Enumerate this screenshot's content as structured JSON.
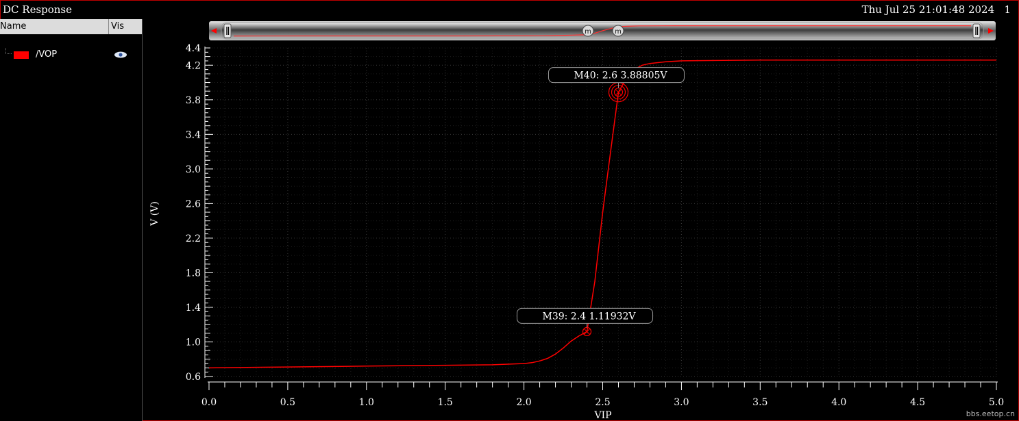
{
  "window": {
    "title": "DC Response",
    "timestamp": "Thu Jul 25 21:01:48 2024",
    "page_number": "1"
  },
  "legend": {
    "header_name": "Name",
    "header_vis": "Vis",
    "items": [
      {
        "label": "/VOP",
        "color": "#ff0000",
        "visibility_icon": "eye-icon"
      }
    ]
  },
  "zoom_bar": {
    "marker_label": "m",
    "left_arrow_icon": "arrow-left-icon",
    "right_arrow_icon": "arrow-right-icon"
  },
  "watermark": "bbs.eetop.cn",
  "chart_data": {
    "type": "line",
    "title": "",
    "xlabel": "VIP",
    "ylabel": "V (V)",
    "xlim": [
      0.0,
      5.0
    ],
    "ylim": [
      0.6,
      4.4
    ],
    "xticks": [
      "0.0",
      "0.5",
      "1.0",
      "1.5",
      "2.0",
      "2.5",
      "3.0",
      "3.5",
      "4.0",
      "4.5",
      "5.0"
    ],
    "yticks": [
      "0.6",
      "1.0",
      "1.4",
      "1.8",
      "2.2",
      "2.6",
      "3.0",
      "3.4",
      "3.8",
      "4.2",
      "4.4"
    ],
    "grid": true,
    "background": "#000000",
    "series": [
      {
        "name": "/VOP",
        "color": "#ff0000",
        "x": [
          0.0,
          0.5,
          1.0,
          1.5,
          1.8,
          2.0,
          2.05,
          2.1,
          2.15,
          2.2,
          2.25,
          2.3,
          2.35,
          2.4,
          2.45,
          2.5,
          2.55,
          2.6,
          2.65,
          2.7,
          2.75,
          2.8,
          2.9,
          3.0,
          3.5,
          4.0,
          4.5,
          5.0
        ],
        "y": [
          0.7,
          0.71,
          0.72,
          0.73,
          0.735,
          0.75,
          0.76,
          0.78,
          0.81,
          0.86,
          0.93,
          1.01,
          1.07,
          1.11932,
          1.7,
          2.5,
          3.2,
          3.88805,
          4.05,
          4.15,
          4.2,
          4.22,
          4.24,
          4.25,
          4.26,
          4.26,
          4.26,
          4.26
        ]
      }
    ],
    "markers": [
      {
        "name": "M39",
        "x": 2.4,
        "y": 1.11932,
        "label": "M39: 2.4 1.11932V"
      },
      {
        "name": "M40",
        "x": 2.6,
        "y": 3.88805,
        "label": "M40: 2.6 3.88805V"
      }
    ]
  }
}
